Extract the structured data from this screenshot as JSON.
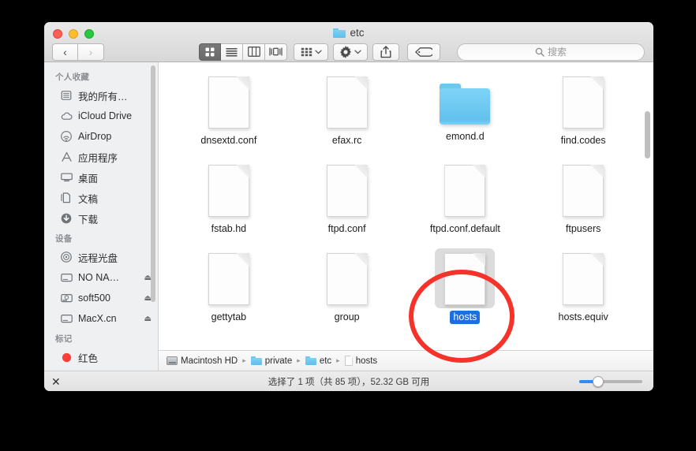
{
  "window": {
    "title": "etc",
    "title_icon": "folder-icon"
  },
  "traffic_lights": {
    "close_label": "close",
    "minimize_label": "minimize",
    "zoom_label": "zoom",
    "close_color": "#ff5f57",
    "minimize_color": "#ffbd2e",
    "zoom_color": "#28c840"
  },
  "toolbar": {
    "back_label": "‹",
    "forward_label": "›",
    "view_icon_label": "icon-view",
    "view_list_label": "list-view",
    "view_column_label": "column-view",
    "view_coverflow_label": "coverflow-view",
    "arrange_label": "arrange-by",
    "action_label": "action-gear",
    "share_label": "share",
    "tag_label": "tag",
    "active_view": "icon-view"
  },
  "search": {
    "placeholder": "搜索",
    "value": "",
    "icon": "search-icon"
  },
  "sidebar": {
    "sections": [
      {
        "header": "个人收藏",
        "items": [
          {
            "label": "我的所有…",
            "icon": "all-my-files-icon",
            "eject": ""
          },
          {
            "label": "iCloud Drive",
            "icon": "icloud-icon",
            "eject": ""
          },
          {
            "label": "AirDrop",
            "icon": "airdrop-icon",
            "eject": ""
          },
          {
            "label": "应用程序",
            "icon": "applications-icon",
            "eject": ""
          },
          {
            "label": "桌面",
            "icon": "desktop-icon",
            "eject": ""
          },
          {
            "label": "文稿",
            "icon": "documents-icon",
            "eject": ""
          },
          {
            "label": "下载",
            "icon": "downloads-icon",
            "eject": ""
          }
        ]
      },
      {
        "header": "设备",
        "items": [
          {
            "label": "远程光盘",
            "icon": "remote-disc-icon",
            "eject": ""
          },
          {
            "label": "NO NA…",
            "icon": "external-drive-icon",
            "eject": "⏏"
          },
          {
            "label": "soft500",
            "icon": "internal-drive-icon",
            "eject": "⏏"
          },
          {
            "label": "MacX.cn",
            "icon": "external-drive-icon",
            "eject": "⏏"
          }
        ]
      },
      {
        "header": "标记",
        "items": [
          {
            "label": "红色",
            "icon": "red-tag-icon",
            "eject": ""
          }
        ]
      }
    ]
  },
  "files": [
    {
      "name": "dnsextd.conf",
      "kind": "document",
      "selected": false
    },
    {
      "name": "efax.rc",
      "kind": "document",
      "selected": false
    },
    {
      "name": "emond.d",
      "kind": "folder",
      "selected": false
    },
    {
      "name": "find.codes",
      "kind": "document",
      "selected": false
    },
    {
      "name": "fstab.hd",
      "kind": "document",
      "selected": false
    },
    {
      "name": "ftpd.conf",
      "kind": "document",
      "selected": false
    },
    {
      "name": "ftpd.conf.default",
      "kind": "document",
      "selected": false
    },
    {
      "name": "ftpusers",
      "kind": "document",
      "selected": false
    },
    {
      "name": "gettytab",
      "kind": "document",
      "selected": false
    },
    {
      "name": "group",
      "kind": "document",
      "selected": false
    },
    {
      "name": "hosts",
      "kind": "document",
      "selected": true
    },
    {
      "name": "hosts.equiv",
      "kind": "document",
      "selected": false
    }
  ],
  "pathbar": {
    "separator": "▸",
    "items": [
      {
        "label": "Macintosh HD",
        "icon": "hard-drive-icon"
      },
      {
        "label": "private",
        "icon": "folder-icon"
      },
      {
        "label": "etc",
        "icon": "folder-icon"
      },
      {
        "label": "hosts",
        "icon": "document-icon"
      }
    ]
  },
  "statusbar": {
    "text": "选择了 1 项（共 85 项），52.32 GB 可用",
    "close_glyph": "✕",
    "zoom_percent": 25
  },
  "annotation": {
    "shape": "ellipse",
    "color": "#f5332b",
    "targets": "hosts"
  }
}
